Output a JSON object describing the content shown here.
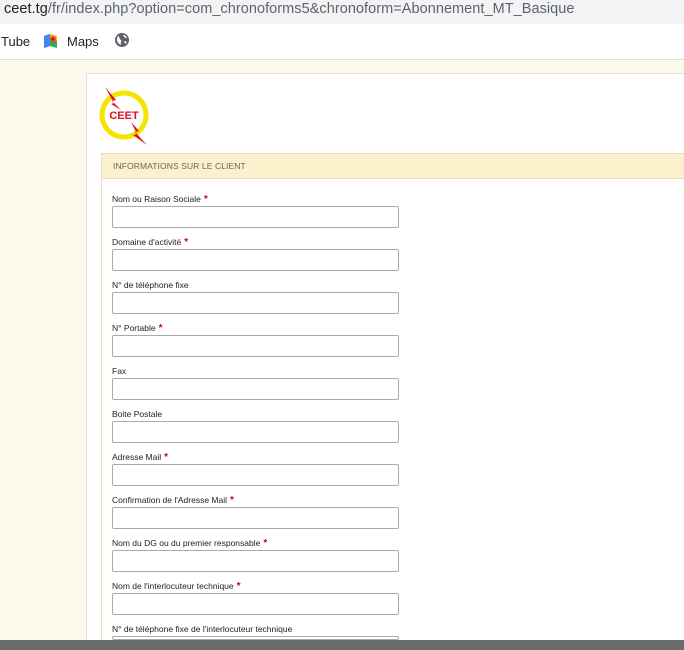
{
  "browser": {
    "url_host": "ceet.tg",
    "url_rest": "/fr/index.php?option=com_chronoforms5&chronoform=Abonnement_MT_Basique",
    "bookmarks": [
      {
        "label": "Tube",
        "icon": "youtube-icon"
      },
      {
        "label": "Maps",
        "icon": "google-maps-icon"
      },
      {
        "label": "",
        "icon": "globe-icon"
      }
    ]
  },
  "logo": {
    "text": "CEET",
    "colors": {
      "ring": "#f4e500",
      "bolt": "#d9121f",
      "text": "#d9121f"
    }
  },
  "section": {
    "title": "INFORMATIONS SUR LE CLIENT"
  },
  "form": {
    "fields": [
      {
        "label": "Nom ou Raison Sociale",
        "required": "*",
        "value": ""
      },
      {
        "label": "Domaine d'activité",
        "required": "*",
        "value": ""
      },
      {
        "label": "N° de téléphone fixe",
        "required": "",
        "value": ""
      },
      {
        "label": "N° Portable",
        "required": "*",
        "value": ""
      },
      {
        "label": "Fax",
        "required": "",
        "value": ""
      },
      {
        "label": "Boite Postale",
        "required": "",
        "value": ""
      },
      {
        "label": "Adresse Mail",
        "required": "*",
        "value": ""
      },
      {
        "label": "Confirmation de l'Adresse Mail",
        "required": "*",
        "value": ""
      },
      {
        "label": "Nom du DG ou du premier responsable",
        "required": "*",
        "value": ""
      },
      {
        "label": "Nom de l'interlocuteur technique",
        "required": "*",
        "value": ""
      },
      {
        "label": "N° de téléphone fixe de l'interlocuteur technique",
        "required": "",
        "value": ""
      }
    ]
  }
}
